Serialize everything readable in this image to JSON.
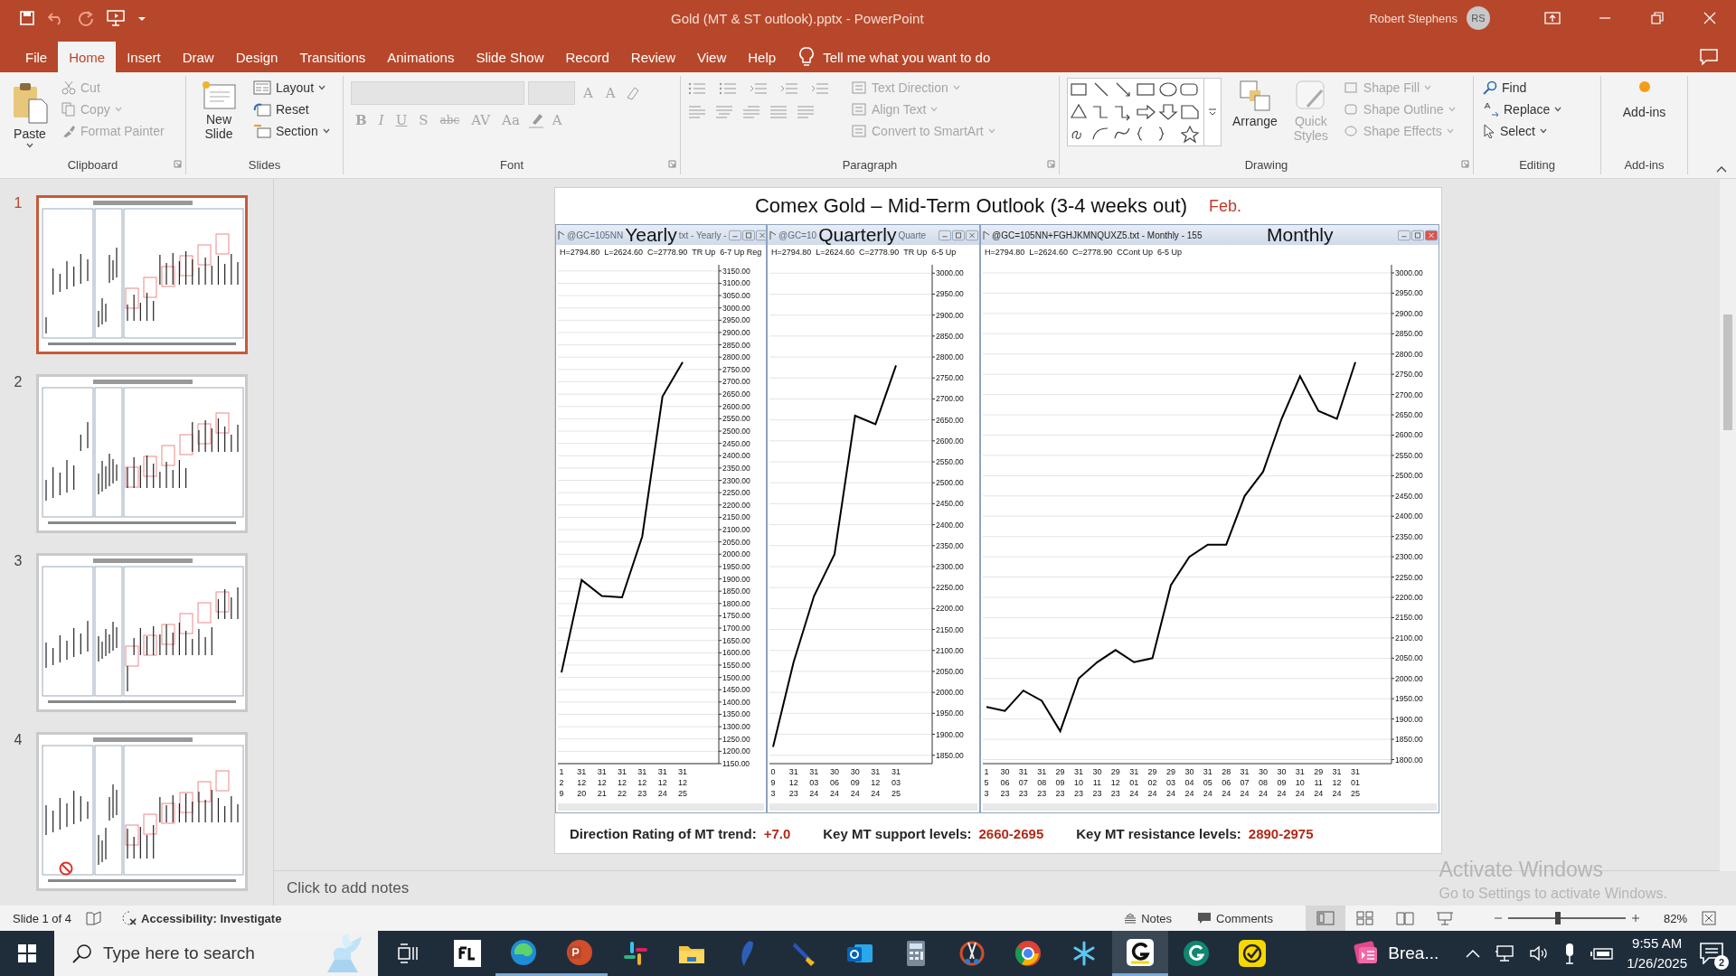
{
  "window": {
    "title": "Gold (MT & ST outlook).pptx  -  PowerPoint",
    "user": "Robert Stephens",
    "initials": "RS"
  },
  "menu_tabs": [
    {
      "label": "File",
      "selected": false
    },
    {
      "label": "Home",
      "selected": true
    },
    {
      "label": "Insert",
      "selected": false
    },
    {
      "label": "Draw",
      "selected": false
    },
    {
      "label": "Design",
      "selected": false
    },
    {
      "label": "Transitions",
      "selected": false
    },
    {
      "label": "Animations",
      "selected": false
    },
    {
      "label": "Slide Show",
      "selected": false
    },
    {
      "label": "Record",
      "selected": false
    },
    {
      "label": "Review",
      "selected": false
    },
    {
      "label": "View",
      "selected": false
    },
    {
      "label": "Help",
      "selected": false
    }
  ],
  "tell_me": "Tell me what you want to do",
  "ribbon": {
    "clipboard": {
      "title": "Clipboard",
      "paste": "Paste",
      "actions": [
        {
          "label": "Cut",
          "disabled": true
        },
        {
          "label": "Copy",
          "disabled": true
        },
        {
          "label": "Format Painter",
          "disabled": true
        }
      ]
    },
    "slides": {
      "title": "Slides",
      "new_slide": "New Slide",
      "actions": [
        {
          "label": "Layout",
          "disabled": false
        },
        {
          "label": "Reset",
          "disabled": false
        },
        {
          "label": "Section",
          "disabled": false
        }
      ]
    },
    "font": {
      "title": "Font",
      "buttons": [
        {
          "label": "A",
          "disabled": true
        },
        {
          "label": "A",
          "disabled": true
        },
        {
          "label": "B",
          "disabled": true
        },
        {
          "label": "I",
          "disabled": true
        },
        {
          "label": "U",
          "disabled": true
        },
        {
          "label": "S",
          "disabled": true
        },
        {
          "label": "abc",
          "disabled": true
        },
        {
          "label": "AV",
          "disabled": true
        },
        {
          "label": "Aa",
          "disabled": true
        },
        {
          "label": "A",
          "disabled": true
        }
      ]
    },
    "paragraph": {
      "title": "Paragraph",
      "actions": [
        {
          "label": "Text Direction",
          "disabled": true
        },
        {
          "label": "Align Text",
          "disabled": true
        },
        {
          "label": "Convert to SmartArt",
          "disabled": true
        }
      ]
    },
    "drawing": {
      "title": "Drawing",
      "arrange": "Arrange",
      "quick_styles": {
        "label": "Quick Styles",
        "disabled": true
      },
      "actions": [
        {
          "label": "Shape Fill",
          "disabled": true
        },
        {
          "label": "Shape Outline",
          "disabled": true
        },
        {
          "label": "Shape Effects",
          "disabled": true
        }
      ]
    },
    "editing": {
      "title": "Editing",
      "actions": [
        {
          "label": "Find",
          "disabled": false
        },
        {
          "label": "Replace",
          "disabled": false
        },
        {
          "label": "Select",
          "disabled": false
        }
      ]
    },
    "addins": {
      "title": "Add-ins",
      "button": "Add-ins"
    }
  },
  "thumbnails": [
    {
      "number": "1",
      "selected": true,
      "flagged": false
    },
    {
      "number": "2",
      "selected": false,
      "flagged": false
    },
    {
      "number": "3",
      "selected": false,
      "flagged": false
    },
    {
      "number": "4",
      "selected": false,
      "flagged": true
    }
  ],
  "slide": {
    "title": "Comex Gold – Mid-Term Outlook (3-4 weeks out)",
    "month": "Feb.",
    "panes": [
      {
        "label": "Yearly",
        "caption_start": "@GC=105NN",
        "caption_end": "txt - Yearly -",
        "info": "H=2794.80  L=2624.60  C=2778.90  TR Up  6-7 Up Reg",
        "close_active": false,
        "chart_data": {
          "type": "line",
          "categories": [
            "1 2 9",
            "31 12 20",
            "31 12 21",
            "31 12 22",
            "31 12 23",
            "31 12 24",
            "31 12 25"
          ],
          "grid": true,
          "series": [
            {
              "color": "#000000",
              "values": [
                1520,
                1895,
                1830,
                1825,
                2072,
                2640,
                2780
              ]
            }
          ],
          "ylim": [
            1150,
            3175
          ],
          "yticks": [
            {
              "value": 1150,
              "label": "1150.00"
            },
            {
              "value": 1200,
              "label": "1200.00"
            },
            {
              "value": 1250,
              "label": "1250.00"
            },
            {
              "value": 1300,
              "label": "1300.00"
            },
            {
              "value": 1350,
              "label": "1350.00"
            },
            {
              "value": 1400,
              "label": "1400.00"
            },
            {
              "value": 1450,
              "label": "1450.00"
            },
            {
              "value": 1500,
              "label": "1500.00"
            },
            {
              "value": 1550,
              "label": "1550.00"
            },
            {
              "value": 1600,
              "label": "1600.00"
            },
            {
              "value": 1650,
              "label": "1650.00"
            },
            {
              "value": 1700,
              "label": "1700.00"
            },
            {
              "value": 1750,
              "label": "1750.00"
            },
            {
              "value": 1800,
              "label": "1800.00"
            },
            {
              "value": 1850,
              "label": "1850.00"
            },
            {
              "value": 1900,
              "label": "1900.00"
            },
            {
              "value": 1950,
              "label": "1950.00"
            },
            {
              "value": 2000,
              "label": "2000.00"
            },
            {
              "value": 2050,
              "label": "2050.00"
            },
            {
              "value": 2100,
              "label": "2100.00"
            },
            {
              "value": 2150,
              "label": "2150.00"
            },
            {
              "value": 2200,
              "label": "2200.00"
            },
            {
              "value": 2250,
              "label": "2250.00"
            },
            {
              "value": 2300,
              "label": "2300.00"
            },
            {
              "value": 2350,
              "label": "2350.00"
            },
            {
              "value": 2400,
              "label": "2400.00"
            },
            {
              "value": 2450,
              "label": "2450.00"
            },
            {
              "value": 2500,
              "label": "2500.00"
            },
            {
              "value": 2550,
              "label": "2550.00"
            },
            {
              "value": 2600,
              "label": "2600.00"
            },
            {
              "value": 2650,
              "label": "2650.00"
            },
            {
              "value": 2700,
              "label": "2700.00"
            },
            {
              "value": 2750,
              "label": "2750.00"
            },
            {
              "value": 2800,
              "label": "2800.00"
            },
            {
              "value": 2850,
              "label": "2850.00"
            },
            {
              "value": 2900,
              "label": "2900.00"
            },
            {
              "value": 2950,
              "label": "2950.00"
            },
            {
              "value": 3000,
              "label": "3000.00"
            },
            {
              "value": 3050,
              "label": "3050.00"
            },
            {
              "value": 3100,
              "label": "3100.00"
            },
            {
              "value": 3150,
              "label": "3150.00"
            }
          ]
        }
      },
      {
        "label": "Quarterly",
        "caption_start": "@GC=10",
        "caption_end": "Quarte",
        "info": "H=2794.80  L=2624.60  C=2778.90  TR Up  6-5 Up",
        "close_active": false,
        "chart_data": {
          "type": "line",
          "categories": [
            "0 9 3",
            "31 12 23",
            "31 03 24",
            "30 06 24",
            "30 09 24",
            "31 12 24",
            "31 03 25"
          ],
          "grid": true,
          "series": [
            {
              "color": "#000000",
              "values": [
                1870,
                2072,
                2230,
                2330,
                2660,
                2640,
                2780
              ]
            }
          ],
          "ylim": [
            1830,
            3020
          ],
          "yticks": [
            {
              "value": 1850,
              "label": "1850.00"
            },
            {
              "value": 1900,
              "label": "1900.00"
            },
            {
              "value": 1950,
              "label": "1950.00"
            },
            {
              "value": 2000,
              "label": "2000.00"
            },
            {
              "value": 2050,
              "label": "2050.00"
            },
            {
              "value": 2100,
              "label": "2100.00"
            },
            {
              "value": 2150,
              "label": "2150.00"
            },
            {
              "value": 2200,
              "label": "2200.00"
            },
            {
              "value": 2250,
              "label": "2250.00"
            },
            {
              "value": 2300,
              "label": "2300.00"
            },
            {
              "value": 2350,
              "label": "2350.00"
            },
            {
              "value": 2400,
              "label": "2400.00"
            },
            {
              "value": 2450,
              "label": "2450.00"
            },
            {
              "value": 2500,
              "label": "2500.00"
            },
            {
              "value": 2550,
              "label": "2550.00"
            },
            {
              "value": 2600,
              "label": "2600.00"
            },
            {
              "value": 2650,
              "label": "2650.00"
            },
            {
              "value": 2700,
              "label": "2700.00"
            },
            {
              "value": 2750,
              "label": "2750.00"
            },
            {
              "value": 2800,
              "label": "2800.00"
            },
            {
              "value": 2850,
              "label": "2850.00"
            },
            {
              "value": 2900,
              "label": "2900.00"
            },
            {
              "value": 2950,
              "label": "2950.00"
            },
            {
              "value": 3000,
              "label": "3000.00"
            }
          ]
        }
      },
      {
        "label": "Monthly",
        "caption_start": "@GC=105NN+FGHJKMNQUXZ5.txt - Monthly - 155",
        "info": "H=2794.80  L=2624.60  C=2778.90  CCont Up  6-5 Up",
        "close_active": true,
        "chart_data": {
          "type": "line",
          "categories": [
            "1 5 3",
            "30 06 23",
            "31 07 23",
            "31 08 23",
            "29 09 23",
            "31 10 23",
            "30 11 23",
            "29 12 23",
            "31 01 24",
            "29 02 24",
            "29 03 24",
            "30 04 24",
            "31 05 24",
            "28 06 24",
            "31 07 24",
            "30 08 24",
            "30 09 24",
            "31 10 24",
            "29 11 24",
            "31 12 24",
            "31 01 25"
          ],
          "grid": true,
          "series": [
            {
              "color": "#000000",
              "values": [
                1930,
                1920,
                1970,
                1945,
                1870,
                2000,
                2040,
                2070,
                2040,
                2050,
                2230,
                2300,
                2330,
                2330,
                2450,
                2510,
                2640,
                2745,
                2660,
                2640,
                2780
              ]
            }
          ],
          "ylim": [
            1790,
            3020
          ],
          "yticks": [
            {
              "value": 1800,
              "label": "1800.00"
            },
            {
              "value": 1850,
              "label": "1850.00"
            },
            {
              "value": 1900,
              "label": "1900.00"
            },
            {
              "value": 1950,
              "label": "1950.00"
            },
            {
              "value": 2000,
              "label": "2000.00"
            },
            {
              "value": 2050,
              "label": "2050.00"
            },
            {
              "value": 2100,
              "label": "2100.00"
            },
            {
              "value": 2150,
              "label": "2150.00"
            },
            {
              "value": 2200,
              "label": "2200.00"
            },
            {
              "value": 2250,
              "label": "2250.00"
            },
            {
              "value": 2300,
              "label": "2300.00"
            },
            {
              "value": 2350,
              "label": "2350.00"
            },
            {
              "value": 2400,
              "label": "2400.00"
            },
            {
              "value": 2450,
              "label": "2450.00"
            },
            {
              "value": 2500,
              "label": "2500.00"
            },
            {
              "value": 2550,
              "label": "2550.00"
            },
            {
              "value": 2600,
              "label": "2600.00"
            },
            {
              "value": 2650,
              "label": "2650.00"
            },
            {
              "value": 2700,
              "label": "2700.00"
            },
            {
              "value": 2750,
              "label": "2750.00"
            },
            {
              "value": 2800,
              "label": "2800.00"
            },
            {
              "value": 2850,
              "label": "2850.00"
            },
            {
              "value": 2900,
              "label": "2900.00"
            },
            {
              "value": 2950,
              "label": "2950.00"
            },
            {
              "value": 3000,
              "label": "3000.00"
            }
          ]
        }
      }
    ],
    "footer": [
      {
        "label": "Direction Rating of MT trend:",
        "value": "+7.0"
      },
      {
        "label": "Key MT support levels:",
        "value": "2660-2695"
      },
      {
        "label": "Key MT resistance levels:",
        "value": "2890-2975"
      }
    ]
  },
  "notes_placeholder": "Click to add notes",
  "activation": {
    "title": "Activate Windows",
    "hint": "Go to Settings to activate Windows."
  },
  "status_bar": {
    "slide": "Slide 1 of 4",
    "accessibility": "Accessibility: Investigate",
    "notes": "Notes",
    "comments": "Comments",
    "views": [
      {
        "selected": true
      },
      {
        "selected": false
      },
      {
        "selected": false
      },
      {
        "selected": false
      }
    ],
    "zoom": {
      "level": 0.42
    },
    "zoom_text": "82%"
  },
  "taskbar": {
    "search": {
      "placeholder": "Type here to search"
    },
    "apps": [
      {
        "running": false,
        "selected": false
      },
      {
        "running": true,
        "selected": false
      },
      {
        "running": true,
        "selected": false
      },
      {
        "running": false,
        "selected": false
      },
      {
        "running": false,
        "selected": false
      },
      {
        "running": false,
        "selected": false
      },
      {
        "running": false,
        "selected": false
      },
      {
        "running": false,
        "selected": false
      },
      {
        "running": false,
        "selected": false
      },
      {
        "running": false,
        "selected": false
      },
      {
        "running": false,
        "selected": false
      },
      {
        "running": false,
        "selected": false
      },
      {
        "running": true,
        "selected": true
      },
      {
        "running": false,
        "selected": false
      },
      {
        "running": false,
        "selected": false
      }
    ],
    "widget": "Brea...",
    "time": "9:55 AM",
    "date": "1/26/2025",
    "notifications": "2"
  }
}
